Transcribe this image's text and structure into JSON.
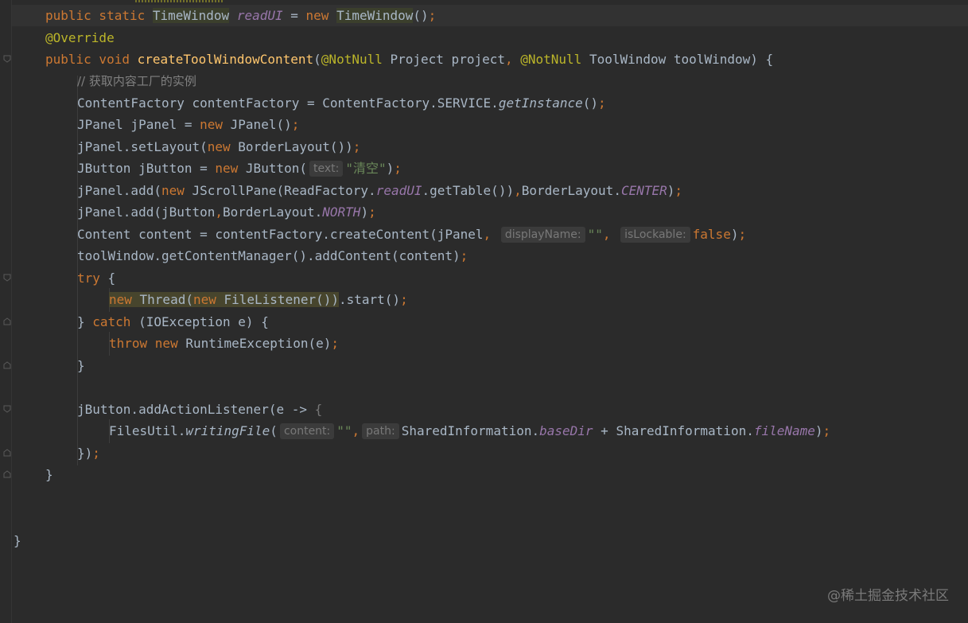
{
  "editor": {
    "lines": {
      "l1": {
        "kw1": "public static ",
        "type1": "TimeWindow",
        "sp": " ",
        "field": "readUI",
        "eq": " = ",
        "kw2": "new ",
        "type2": "TimeWindow",
        "end": "()",
        ";": ";"
      },
      "l2": {
        "ann": "@Override"
      },
      "l3": {
        "kw": "public void ",
        "fn": "createToolWindowContent",
        "p1": "(",
        "ann1": "@NotNull",
        "t1": " Project project",
        ",": ", ",
        "ann2": "@NotNull",
        "t2": " ToolWindow toolWindow) {"
      },
      "l4": {
        "cmt": "// 获取内容工厂的实例"
      },
      "l5": {
        "a": "ContentFactory contentFactory = ContentFactory.SERVICE.",
        "it": "getInstance",
        "b": "()",
        ";": ";"
      },
      "l6": {
        "a": "JPanel jPanel = ",
        "kw": "new ",
        "b": "JPanel()",
        ";": ";"
      },
      "l7": {
        "a": "jPanel.setLayout(",
        "kw": "new ",
        "b": "BorderLayout())",
        ";": ";"
      },
      "l8": {
        "a": "JButton jButton = ",
        "kw": "new ",
        "b": "JButton(",
        "hint": "text:",
        "str": "\"清空\"",
        "c": ")",
        ";": ";"
      },
      "l9": {
        "a": "jPanel.add(",
        "kw": "new ",
        "b": "JScrollPane(ReadFactory.",
        "fld": "readUI",
        "c": ".getTable())",
        ",": ",",
        "d": "BorderLayout.",
        "fld2": "CENTER",
        "e": ")",
        ";": ";"
      },
      "l10": {
        "a": "jPanel.add(jButton",
        ",": ",",
        "b": "BorderLayout.",
        "fld": "NORTH",
        "c": ")",
        ";": ";"
      },
      "l11": {
        "a": "Content content = contentFactory.createContent(jPanel",
        ",": ",",
        "hint1": "displayName:",
        "str": "\"\"",
        "c2": ",",
        "hint2": "isLockable:",
        "kw": "false",
        "e": ")",
        ";": ";"
      },
      "l12": {
        "a": "toolWindow.getContentManager().addContent(content)",
        ";": ";"
      },
      "l13": {
        "kw": "try",
        "a": " {"
      },
      "l14": {
        "kw1": "new ",
        "a": "Thread(",
        "kw2": "new ",
        "b": "FileListener())",
        "c": ".start()",
        ";": ";"
      },
      "l15": {
        "a": "} ",
        "kw": "catch",
        "b": " (IOException e) {"
      },
      "l16": {
        "kw1": "throw ",
        "kw2": "new ",
        "a": "RuntimeException(e)",
        ";": ";"
      },
      "l17": {
        "a": "}"
      },
      "l19": {
        "a": "jButton.addActionListener(e -> ",
        "b": "{"
      },
      "l20": {
        "a": "FilesUtil.",
        "it": "writingFile",
        "b": "(",
        "hint1": "content:",
        "str": "\"\"",
        ",": ",",
        "hint2": "path:",
        "c": "SharedInformation.",
        "fld": "baseDir",
        "d": " + SharedInformation.",
        "fld2": "fileName",
        "e": ")",
        ";": ";"
      },
      "l21": {
        "a": "})",
        ";": ";"
      },
      "l22": {
        "a": "}"
      },
      "l25": {
        "a": "}"
      }
    }
  },
  "icons": {
    "bulb": "lightbulb-icon",
    "fold": "fold-marker-icon"
  },
  "watermark": "@稀土掘金技术社区",
  "colors": {
    "background": "#2b2b2b",
    "keyword": "#cc7832",
    "annotation": "#bbb529",
    "method": "#ffc66d",
    "field": "#9876aa",
    "string": "#6a8759",
    "comment": "#808080",
    "text": "#a9b7c6"
  }
}
